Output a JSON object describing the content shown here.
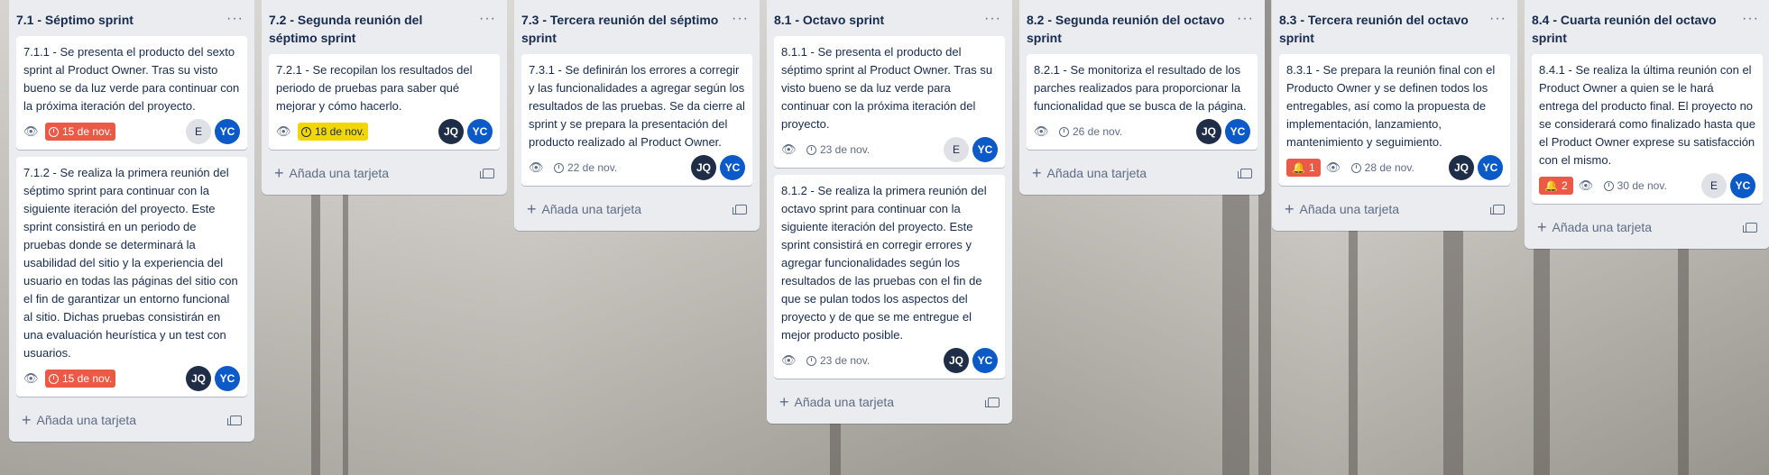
{
  "lists": [
    {
      "title": "7.1 - Séptimo sprint",
      "add_label": "Añada una tarjeta",
      "cards": [
        {
          "text": "7.1.1 - Se presenta el producto del sexto sprint al Product Owner. Tras su visto bueno se da luz verde para continuar con la próxima iteración del proyecto.",
          "due": "15 de nov.",
          "due_style": "red",
          "members": [
            "E",
            "YC"
          ]
        },
        {
          "text": "7.1.2 - Se realiza la primera reunión del séptimo sprint para continuar con la siguiente iteración del proyecto. Este sprint consistirá en un periodo de pruebas donde se determinará la usabilidad del sitio y la experiencia del usuario en todas las páginas del sitio con el fin de garantizar un entorno funcional al sitio. Dichas pruebas consistirán en una evaluación heurística y un test con usuarios.",
          "due": "15 de nov.",
          "due_style": "red",
          "members": [
            "JQ",
            "YC"
          ]
        }
      ]
    },
    {
      "title": "7.2 - Segunda reunión del séptimo sprint",
      "add_label": "Añada una tarjeta",
      "cards": [
        {
          "text": "7.2.1 - Se recopilan los resultados del periodo de pruebas para saber qué mejorar y cómo hacerlo.",
          "due": "18 de nov.",
          "due_style": "yellow",
          "members": [
            "JQ",
            "YC"
          ]
        }
      ]
    },
    {
      "title": "7.3 - Tercera reunión del séptimo sprint",
      "add_label": "Añada una tarjeta",
      "cards": [
        {
          "text": "7.3.1 - Se definirán los errores a corregir y las funcionalidades a agregar según los resultados de las pruebas. Se da cierre al sprint y se prepara la presentación del producto realizado al Product Owner.",
          "due": "22 de nov.",
          "due_style": "plain",
          "members": [
            "JQ",
            "YC"
          ]
        }
      ]
    },
    {
      "title": "8.1 - Octavo sprint",
      "add_label": "Añada una tarjeta",
      "cards": [
        {
          "text": "8.1.1 - Se presenta el producto del séptimo sprint al Product Owner. Tras su visto bueno se da luz verde para continuar con la próxima iteración del proyecto.",
          "due": "23 de nov.",
          "due_style": "plain",
          "members": [
            "E",
            "YC"
          ]
        },
        {
          "text": "8.1.2 - Se realiza la primera reunión del octavo sprint para continuar con la siguiente iteración del proyecto. Este sprint consistirá en corregir errores y agregar funcionalidades según los resultados de las pruebas con el fin de que se pulan todos los aspectos del proyecto y de que se me entregue el mejor producto posible.",
          "due": "23 de nov.",
          "due_style": "plain",
          "members": [
            "JQ",
            "YC"
          ]
        }
      ]
    },
    {
      "title": "8.2 - Segunda reunión del octavo sprint",
      "add_label": "Añada una tarjeta",
      "cards": [
        {
          "text": "8.2.1 - Se monitoriza el resultado de los parches realizados para proporcionar la funcionalidad que se busca de la página.",
          "due": "26 de nov.",
          "due_style": "plain",
          "members": [
            "JQ",
            "YC"
          ]
        }
      ]
    },
    {
      "title": "8.3 - Tercera reunión del octavo sprint",
      "add_label": "Añada una tarjeta",
      "cards": [
        {
          "text": "8.3.1 - Se prepara la reunión final con el Producto Owner y se definen todos los entregables, así como la propuesta de implementación, lanzamiento, mantenimiento y seguimiento.",
          "notif": "1",
          "due": "28 de nov.",
          "due_style": "plain",
          "members": [
            "JQ",
            "YC"
          ]
        }
      ]
    },
    {
      "title": "8.4 - Cuarta reunión del octavo sprint",
      "add_label": "Añada una tarjeta",
      "cards": [
        {
          "text": "8.4.1 - Se realiza la última reunión con el Product Owner a quien se le hará entrega del producto final. El proyecto no se considerará como finalizado hasta que el Product Owner exprese su satisfacción con el mismo.",
          "notif": "2",
          "due": "30 de nov.",
          "due_style": "plain",
          "members": [
            "E",
            "YC"
          ]
        }
      ]
    }
  ],
  "colors": {
    "red": "#eb5a46",
    "yellow": "#f2d600",
    "avatar_dark": "#1f2d46",
    "avatar_blue": "#0c5ac8"
  }
}
